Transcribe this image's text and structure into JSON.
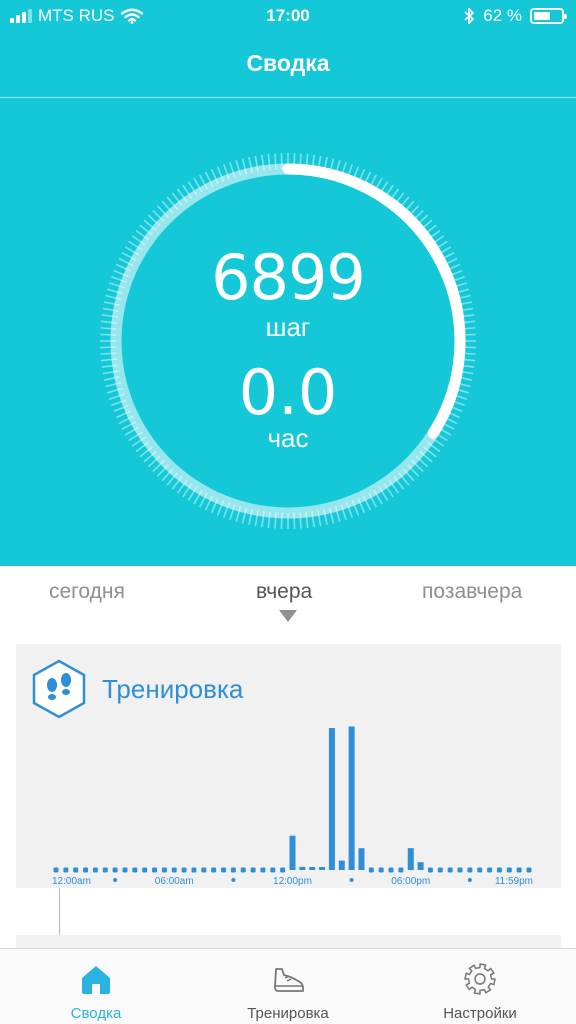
{
  "status_bar": {
    "carrier": "MTS RUS",
    "time": "17:00",
    "battery_percent": "62 %",
    "battery_level": 0.62,
    "icons": [
      "signal-icon",
      "wifi-icon",
      "bluetooth-icon",
      "battery-icon"
    ]
  },
  "header": {
    "title": "Сводка"
  },
  "summary": {
    "steps_value": "6899",
    "steps_unit": "шаг",
    "hours_value": "0.0",
    "hours_unit": "час",
    "goal_progress": 0.34
  },
  "day_selector": {
    "days": [
      "сегодня",
      "вчера",
      "позавчера"
    ],
    "selected_index": 1
  },
  "workout_card": {
    "title": "Тренировка",
    "icon": "footprints-icon"
  },
  "chart_data": {
    "type": "bar",
    "title": "Тренировка",
    "x_ticks": [
      "12:00am",
      "06:00am",
      "12:00pm",
      "06:00pm",
      "11:59pm"
    ],
    "x": [
      0,
      1,
      2,
      3,
      4,
      5,
      6,
      7,
      8,
      9,
      10,
      11,
      12,
      13,
      14,
      15,
      16,
      17,
      18,
      19,
      20,
      21,
      22,
      23,
      24,
      25,
      26,
      27,
      28,
      29,
      30,
      31,
      32,
      33,
      34,
      35,
      36,
      37,
      38,
      39,
      40,
      41,
      42,
      43,
      44,
      45,
      46,
      47,
      48
    ],
    "values": [
      0,
      0,
      0,
      0,
      0,
      0,
      0,
      0,
      0,
      0,
      0,
      0,
      0,
      0,
      0,
      0,
      0,
      0,
      0,
      0,
      0,
      0,
      0,
      0,
      0.22,
      0.02,
      0.01,
      0.01,
      0.91,
      0.06,
      0.92,
      0.14,
      0,
      0,
      0,
      0,
      0.14,
      0.05,
      0,
      0,
      0,
      0,
      0,
      0,
      0,
      0,
      0,
      0,
      0
    ],
    "ylim": [
      0,
      1
    ],
    "color": "#2e8fd8"
  },
  "tab_bar": {
    "tabs": [
      {
        "label": "Сводка",
        "icon": "home-icon",
        "active": true
      },
      {
        "label": "Тренировка",
        "icon": "sneaker-icon",
        "active": false
      },
      {
        "label": "Настройки",
        "icon": "gear-icon",
        "active": false
      }
    ]
  },
  "colors": {
    "accent": "#14c8d8",
    "chart_blue": "#2e8fd8",
    "tab_active": "#2ab3e0"
  }
}
